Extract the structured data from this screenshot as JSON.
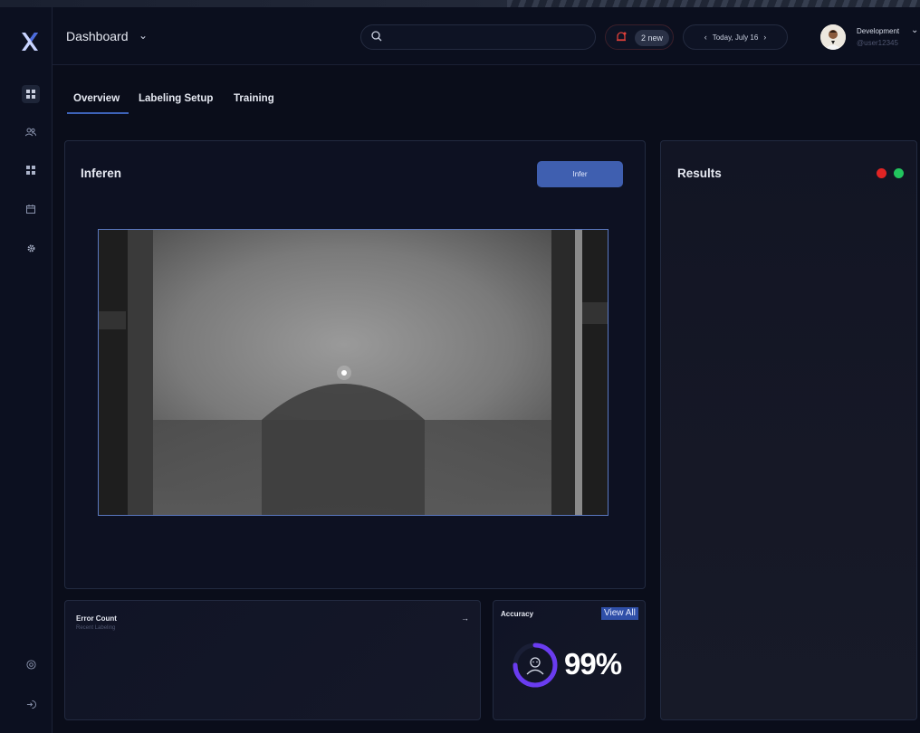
{
  "header": {
    "title": "Dashboard",
    "search_placeholder": "",
    "notifications_badge": "2 new",
    "date_label": "Today, July 16",
    "user": {
      "name": "Development",
      "handle": "@user12345"
    }
  },
  "sidebar": {
    "items": [
      {
        "icon": "dashboard-icon",
        "active": true
      },
      {
        "icon": "users-icon",
        "active": false
      },
      {
        "icon": "grid-icon",
        "active": false
      },
      {
        "icon": "calendar-icon",
        "active": false
      },
      {
        "icon": "gear-icon",
        "active": false
      }
    ],
    "bottom_items": [
      {
        "icon": "settings-circle-icon"
      },
      {
        "icon": "logout-icon"
      }
    ]
  },
  "tabs": [
    {
      "label": "Overview",
      "active": true
    },
    {
      "label": "Labeling Setup",
      "active": false
    },
    {
      "label": "Training",
      "active": false
    }
  ],
  "inference": {
    "title": "Inferen",
    "button_label": "Infer"
  },
  "results": {
    "title": "Results",
    "status_colors": [
      "#e02424",
      "#22c55e"
    ]
  },
  "error_count": {
    "title": "Error Count",
    "subtitle": "Recent Labeling",
    "arrow": "→"
  },
  "accuracy": {
    "title": "Accuracy",
    "view_all": "View All",
    "value": "99%",
    "percent": 99
  },
  "colors": {
    "accent": "#3f5fb0",
    "background": "#0a0d1a",
    "card": "#0d1122",
    "ring": "#6a3cf0"
  }
}
